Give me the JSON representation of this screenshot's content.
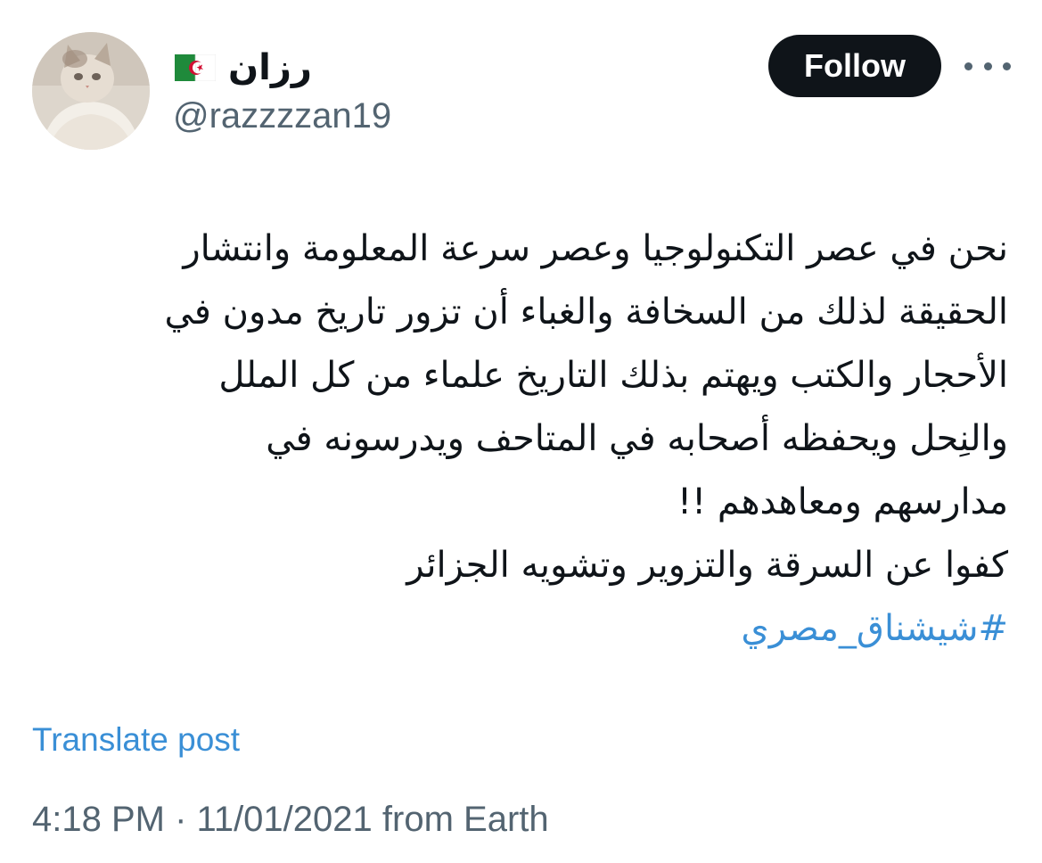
{
  "author": {
    "display_name": "رزان",
    "flag_emoji": "🇩🇿",
    "handle": "@razzzzan19",
    "avatar": "cat-avatar"
  },
  "actions": {
    "follow_label": "Follow",
    "more_icon": "more-horizontal-icon"
  },
  "tweet": {
    "lines": [
      "نحن في عصر التكنولوجيا وعصر سرعة المعلومة وانتشار",
      "الحقيقة لذلك من السخافة والغباء أن تزور تاريخ مدون في",
      "الأحجار والكتب ويهتم بذلك التاريخ علماء من كل الملل",
      "والنِحل ويحفظه أصحابه في المتاحف ويدرسونه في",
      "مدارسهم ومعاهدهم !!",
      "كفوا عن السرقة والتزوير وتشويه الجزائر"
    ],
    "hashtag": "#شيشناق_مصري"
  },
  "translate_label": "Translate post",
  "meta": {
    "time": "4:18 PM",
    "separator": "·",
    "date": "11/01/2021",
    "source": "from Earth"
  },
  "colors": {
    "text": "#0f1419",
    "secondary": "#536471",
    "link": "#3a8fd6",
    "button_bg": "#0f1419",
    "button_text": "#ffffff"
  }
}
